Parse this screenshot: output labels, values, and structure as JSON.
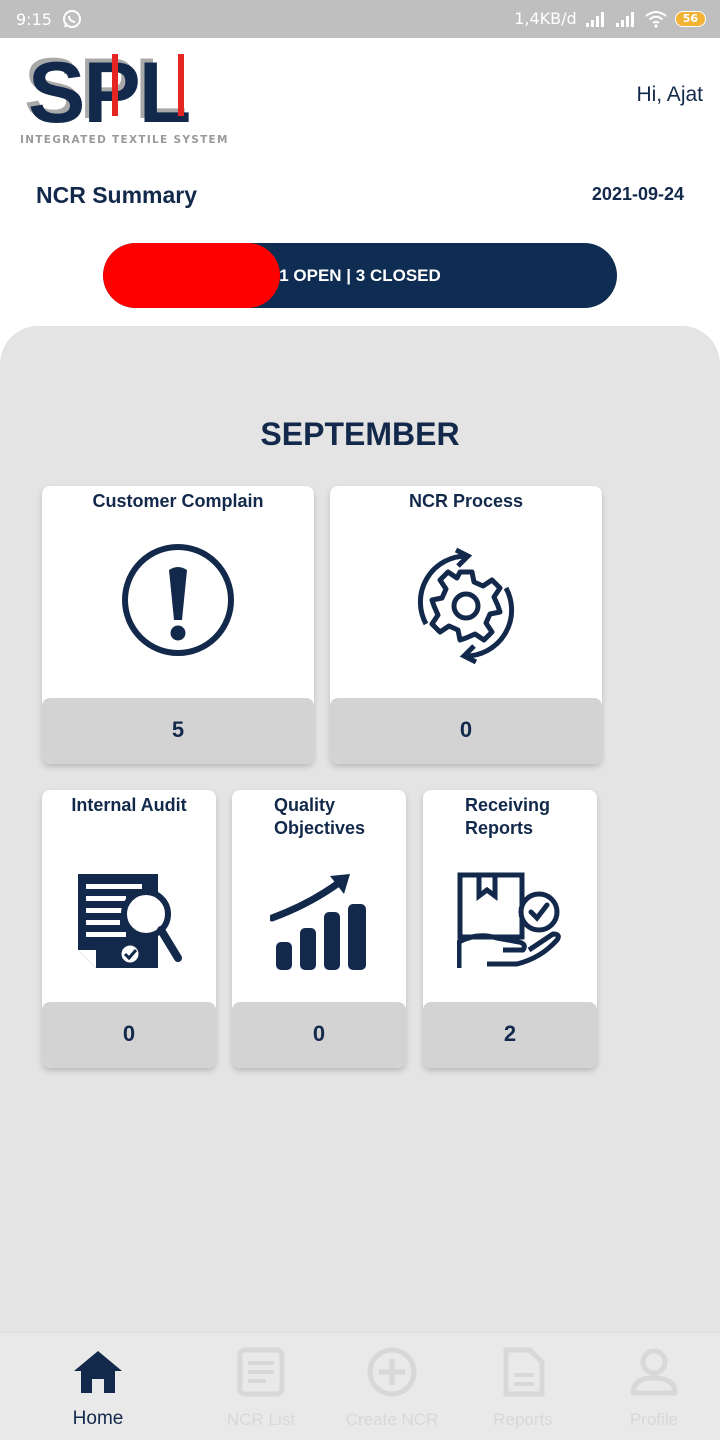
{
  "status_bar": {
    "time": "9:15",
    "network_speed": "1,4KB/d",
    "battery": "56"
  },
  "header": {
    "logo_text": "SPL",
    "logo_tagline": "INTEGRATED TEXTILE SYSTEM",
    "greeting": "Hi, Ajat"
  },
  "summary": {
    "title": "NCR Summary",
    "date": "2021-09-24",
    "status_label": "1 OPEN | 3 CLOSED",
    "open": 1,
    "closed": 3,
    "open_fraction": 0.345
  },
  "month": "SEPTEMBER",
  "cards": {
    "customer_complain": {
      "title": "Customer Complain",
      "count": "5"
    },
    "ncr_process": {
      "title": "NCR Process",
      "count": "0"
    },
    "internal_audit": {
      "title": "Internal Audit",
      "count": "0"
    },
    "quality_objectives": {
      "title_line1": "Quality",
      "title_line2": "Objectives",
      "count": "0"
    },
    "receiving_reports": {
      "title_line1": "Receiving",
      "title_line2": "Reports",
      "count": "2"
    }
  },
  "nav": {
    "home": "Home",
    "ncr_list": "NCR List",
    "create_ncr": "Create NCR",
    "reports": "Reports",
    "profile": "Profile"
  },
  "colors": {
    "navy": "#13294b",
    "open_red": "#ff0000",
    "panel_gray": "#e4e4e4",
    "count_gray": "#d3d3d3"
  }
}
